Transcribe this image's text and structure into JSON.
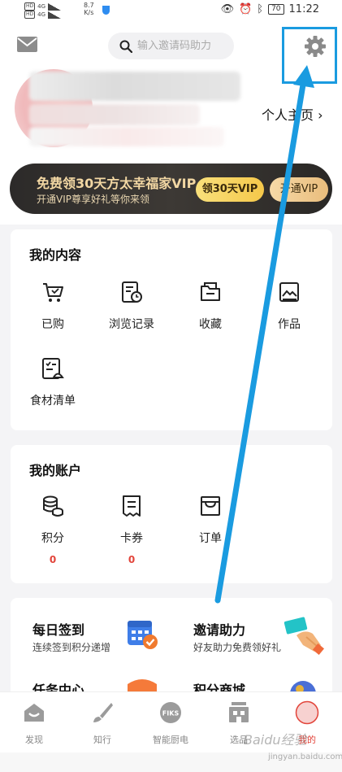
{
  "status_bar": {
    "network_speed": "8.7",
    "network_unit": "K/s",
    "signal_a": "4G",
    "signal_b": "4G",
    "hd": "HD",
    "battery": "70",
    "time": "11:22"
  },
  "header": {
    "search_placeholder": "输入邀请码助力",
    "profile_link": "个人主页 ›"
  },
  "vip_banner": {
    "title": "免费领30天方太幸福家VIP",
    "subtitle": "开通VIP尊享好礼等你来领",
    "claim_button": "领30天VIP",
    "open_button": "开通VIP"
  },
  "my_content": {
    "title": "我的内容",
    "items": [
      {
        "label": "已购",
        "icon": "cart-icon"
      },
      {
        "label": "浏览记录",
        "icon": "history-icon"
      },
      {
        "label": "收藏",
        "icon": "folder-icon"
      },
      {
        "label": "作品",
        "icon": "image-icon"
      },
      {
        "label": "食材清单",
        "icon": "checklist-icon"
      }
    ]
  },
  "my_account": {
    "title": "我的账户",
    "items": [
      {
        "label": "积分",
        "count": "0",
        "icon": "coins-icon"
      },
      {
        "label": "卡券",
        "count": "0",
        "icon": "coupon-icon"
      },
      {
        "label": "订单",
        "icon": "order-icon"
      }
    ]
  },
  "daily": {
    "items": [
      {
        "title": "每日签到",
        "subtitle": "连续签到积分递增"
      },
      {
        "title": "邀请助力",
        "subtitle": "好友助力免费领好礼"
      },
      {
        "title": "任务中心",
        "subtitle": ""
      },
      {
        "title": "积分商城",
        "subtitle": ""
      }
    ]
  },
  "tabbar": {
    "tabs": [
      {
        "label": "发现"
      },
      {
        "label": "知行"
      },
      {
        "label": "智能厨电"
      },
      {
        "label": "选品"
      },
      {
        "label": "我的"
      }
    ],
    "fiks_text": "FIKS",
    "active_color": "#e2443a"
  },
  "watermark": {
    "text": "Baidu经验",
    "url": "jingyan.baidu.com"
  },
  "colors": {
    "accent_blue": "#1a9be0",
    "vip_gold": "#f2d7a3",
    "count_red": "#e2443a"
  }
}
